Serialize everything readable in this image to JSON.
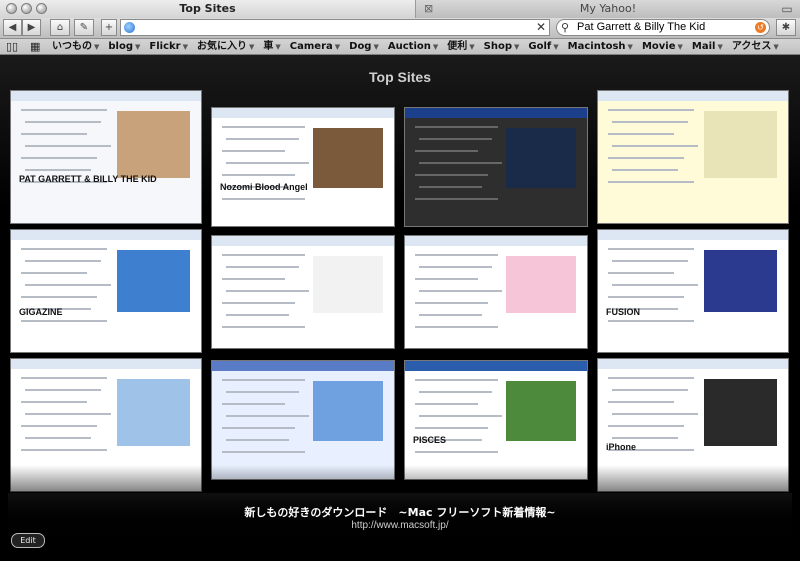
{
  "tabs": [
    {
      "title": "Top Sites",
      "active": true
    },
    {
      "title": "My Yahoo!",
      "active": false
    }
  ],
  "toolbar": {
    "url_value": "",
    "search_value": "Pat Garrett & Billy The Kid"
  },
  "bookmarks": [
    {
      "label": "いつもの",
      "menu": true
    },
    {
      "label": "blog",
      "menu": true
    },
    {
      "label": "Flickr",
      "menu": true
    },
    {
      "label": "お気に入り",
      "menu": true
    },
    {
      "label": "車",
      "menu": true
    },
    {
      "label": "Camera",
      "menu": true
    },
    {
      "label": "Dog",
      "menu": true
    },
    {
      "label": "Auction",
      "menu": true
    },
    {
      "label": "便利",
      "menu": true
    },
    {
      "label": "Shop",
      "menu": true
    },
    {
      "label": "Golf",
      "menu": true
    },
    {
      "label": "Macintosh",
      "menu": true
    },
    {
      "label": "Movie",
      "menu": true
    },
    {
      "label": "Mail",
      "menu": true
    },
    {
      "label": "アクセス",
      "menu": true
    }
  ],
  "content": {
    "title": "Top Sites",
    "hovered_site_name": "新しもの好きのダウンロード　~Mac フリーソフト新着情報~",
    "hovered_site_url": "http://www.macsoft.jp/",
    "edit_label": "Edit"
  },
  "thumbnails": [
    {
      "id": "blog-pat-garrett",
      "caption": "PAT GARRETT & BILLY THE KID",
      "accent": "#f5f7fb"
    },
    {
      "id": "nozomi-blog",
      "caption": "Nozomi Blood Angel",
      "accent": "#ffffff"
    },
    {
      "id": "dark-blog",
      "caption": "",
      "accent": "#2e2e2e"
    },
    {
      "id": "yellow-page",
      "caption": "",
      "accent": "#fffbd9"
    },
    {
      "id": "gigazine",
      "caption": "GIGAZINE",
      "accent": "#ffffff"
    },
    {
      "id": "comic-blog",
      "caption": "",
      "accent": "#ffffff"
    },
    {
      "id": "sketch-blog",
      "caption": "",
      "accent": "#ffffff"
    },
    {
      "id": "fusion-shop",
      "caption": "FUSION",
      "accent": "#ffffff"
    },
    {
      "id": "macsoft",
      "caption": "",
      "accent": "#ffffff"
    },
    {
      "id": "blue-blog",
      "caption": "",
      "accent": "#e8f0ff"
    },
    {
      "id": "pisces",
      "caption": "PISCES",
      "accent": "#ffffff"
    },
    {
      "id": "iphone-site",
      "caption": "iPhone",
      "accent": "#ffffff"
    }
  ]
}
